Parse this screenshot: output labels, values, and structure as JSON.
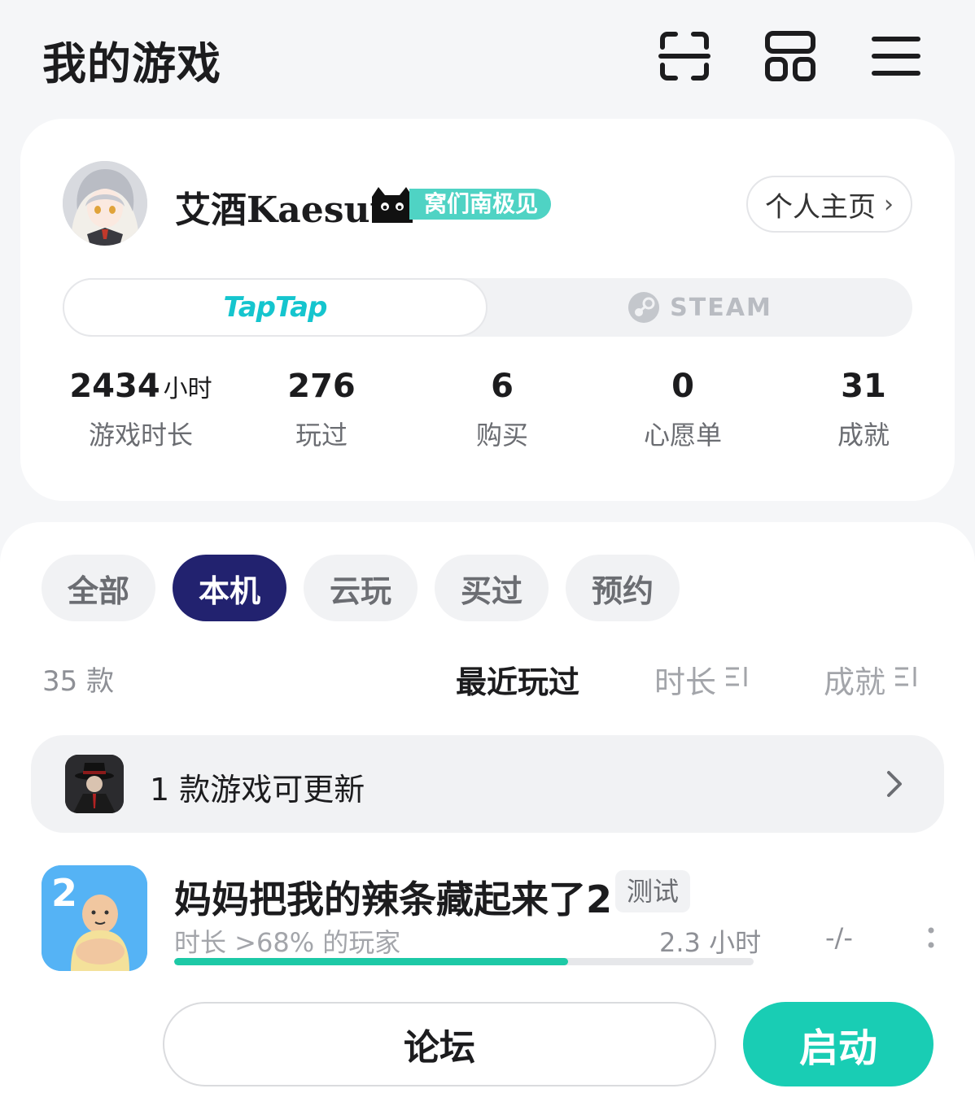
{
  "header": {
    "title": "我的游戏",
    "icons": [
      "scan-icon",
      "grid-icon",
      "menu-icon"
    ]
  },
  "profile": {
    "username": "艾酒Kaesuu",
    "badge_text": "窝们南极见",
    "home_button": "个人主页",
    "platforms": {
      "taptap": "TapTap",
      "steam": "STEAM",
      "active": "taptap"
    },
    "stats": [
      {
        "value": "2434",
        "unit": "小时",
        "label": "游戏时长"
      },
      {
        "value": "276",
        "unit": "",
        "label": "玩过"
      },
      {
        "value": "6",
        "unit": "",
        "label": "购买"
      },
      {
        "value": "0",
        "unit": "",
        "label": "心愿单"
      },
      {
        "value": "31",
        "unit": "",
        "label": "成就"
      }
    ]
  },
  "filters": {
    "chips": [
      "全部",
      "本机",
      "云玩",
      "买过",
      "预约"
    ],
    "active": "本机"
  },
  "list": {
    "count": "35 款",
    "sort_options": [
      "最近玩过",
      "时长",
      "成就"
    ],
    "active_sort": "最近玩过"
  },
  "update_banner": {
    "text": "1 款游戏可更新"
  },
  "game": {
    "icon_number": "2",
    "title": "妈妈把我的辣条藏起来了2",
    "tag": "测试",
    "stat_text": "时长 >68% 的玩家",
    "hours": "2.3 小时",
    "progress": 0.68,
    "achievements": "-/-"
  },
  "actions": {
    "forum": "论坛",
    "launch": "启动"
  },
  "colors": {
    "accent": "#19cdb4",
    "chip_active": "#22226f",
    "badge": "#4fd3c4",
    "taptap": "#15c5ce"
  }
}
